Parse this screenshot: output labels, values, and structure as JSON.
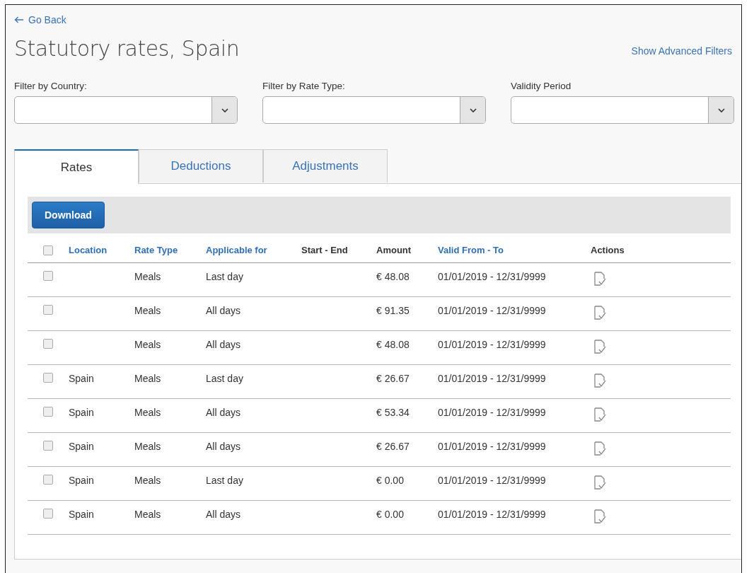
{
  "back_link": "Go Back",
  "title": "Statutory rates, Spain",
  "advanced_filters_link": "Show Advanced Filters",
  "filters": [
    {
      "label": "Filter by Country:"
    },
    {
      "label": "Filter by Rate Type:"
    },
    {
      "label": "Validity Period"
    }
  ],
  "tabs": [
    {
      "label": "Rates",
      "selected": true
    },
    {
      "label": "Deductions",
      "selected": false
    },
    {
      "label": "Adjustments",
      "selected": false
    }
  ],
  "toolbar": {
    "download_button": "Download"
  },
  "table": {
    "select_all_checked": false,
    "columns": [
      {
        "label": "Location",
        "sortable": true
      },
      {
        "label": "Rate Type",
        "sortable": true
      },
      {
        "label": "Applicable for",
        "sortable": true
      },
      {
        "label": "Start - End",
        "sortable": false
      },
      {
        "label": "Amount",
        "sortable": false
      },
      {
        "label": "Valid From - To",
        "sortable": true
      },
      {
        "label": "Actions",
        "sortable": false
      }
    ],
    "rows": [
      {
        "checked": false,
        "location": "",
        "rate_type": "Meals",
        "applicable_for": "Last day",
        "amount": "€ 48.08",
        "valid": "01/01/2019 - 12/31/9999"
      },
      {
        "checked": false,
        "location": "",
        "rate_type": "Meals",
        "applicable_for": "All days",
        "amount": "€ 91.35",
        "valid": "01/01/2019 - 12/31/9999"
      },
      {
        "checked": false,
        "location": "",
        "rate_type": "Meals",
        "applicable_for": "All days",
        "amount": "€ 48.08",
        "valid": "01/01/2019 - 12/31/9999"
      },
      {
        "checked": false,
        "location": "Spain",
        "rate_type": "Meals",
        "applicable_for": "Last day",
        "amount": "€ 26.67",
        "valid": "01/01/2019 - 12/31/9999"
      },
      {
        "checked": false,
        "location": "Spain",
        "rate_type": "Meals",
        "applicable_for": "All days",
        "amount": "€ 53.34",
        "valid": "01/01/2019 - 12/31/9999"
      },
      {
        "checked": false,
        "location": "Spain",
        "rate_type": "Meals",
        "applicable_for": "All days",
        "amount": "€ 26.67",
        "valid": "01/01/2019 - 12/31/9999"
      },
      {
        "checked": false,
        "location": "Spain",
        "rate_type": "Meals",
        "applicable_for": "Last day",
        "amount": "€ 0.00",
        "valid": "01/01/2019 - 12/31/9999"
      },
      {
        "checked": false,
        "location": "Spain",
        "rate_type": "Meals",
        "applicable_for": "All days",
        "amount": "€ 0.00",
        "valid": "01/01/2019 - 12/31/9999"
      }
    ]
  }
}
